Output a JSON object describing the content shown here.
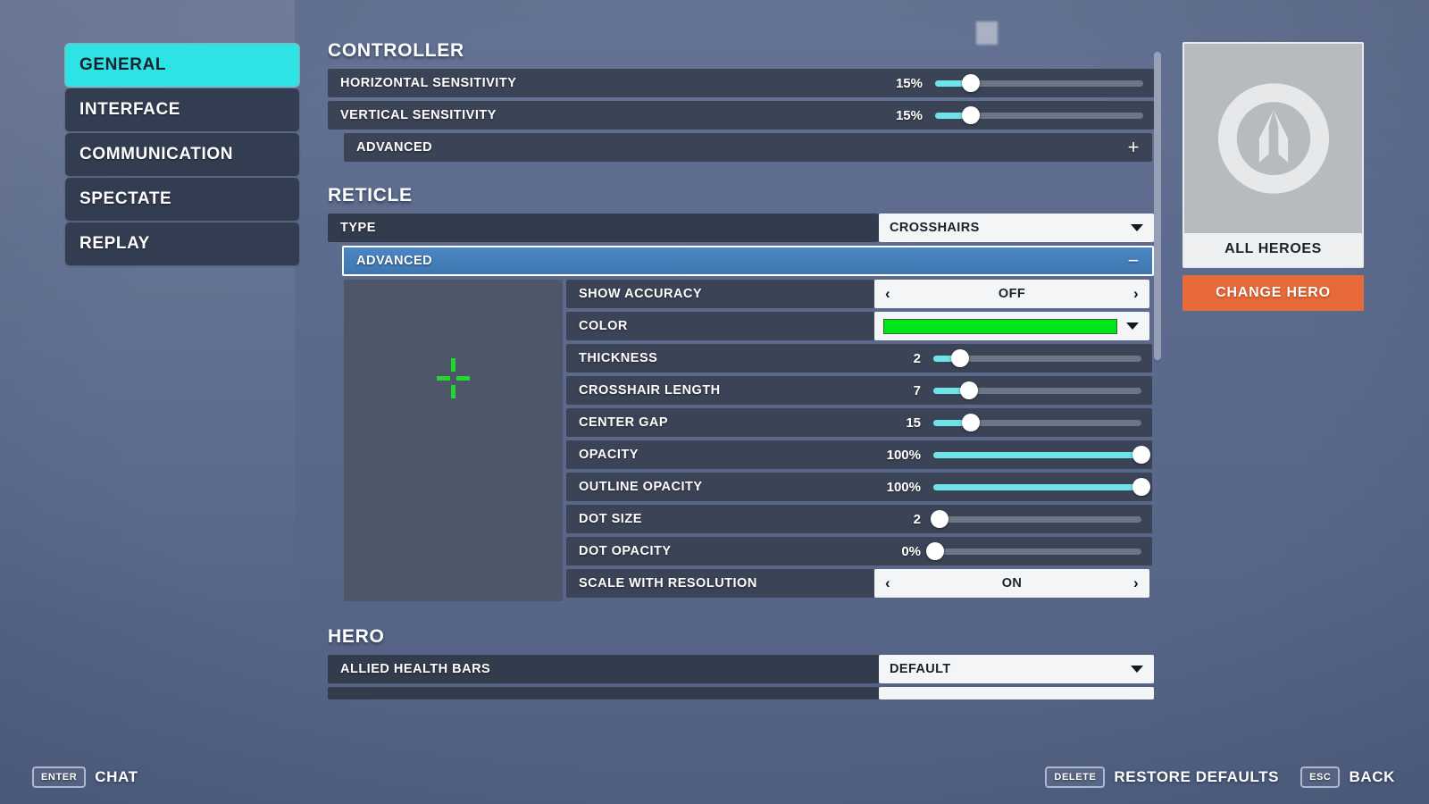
{
  "theme": {
    "accent_cyan": "#2de3e3",
    "slider_fill": "#6fe3e8",
    "selected_blue": "#4a87c4",
    "crosshair_green": "#21d832",
    "change_hero_orange": "#e8693a",
    "row_dark": "#3b4456"
  },
  "sidebar": {
    "items": [
      {
        "label": "GENERAL",
        "active": true
      },
      {
        "label": "INTERFACE",
        "active": false
      },
      {
        "label": "COMMUNICATION",
        "active": false
      },
      {
        "label": "SPECTATE",
        "active": false
      },
      {
        "label": "REPLAY",
        "active": false
      }
    ]
  },
  "sections": {
    "controller": {
      "title": "CONTROLLER",
      "horizontal_sensitivity": {
        "label": "HORIZONTAL SENSITIVITY",
        "value": "15%",
        "percent": 17
      },
      "vertical_sensitivity": {
        "label": "VERTICAL SENSITIVITY",
        "value": "15%",
        "percent": 17
      },
      "advanced": {
        "label": "ADVANCED",
        "sign": "+"
      }
    },
    "reticle": {
      "title": "RETICLE",
      "type": {
        "label": "TYPE",
        "value": "CROSSHAIRS"
      },
      "advanced": {
        "label": "ADVANCED",
        "sign": "−"
      },
      "show_accuracy": {
        "label": "SHOW ACCURACY",
        "value": "OFF",
        "left_arrow": "‹",
        "right_arrow": "›"
      },
      "color": {
        "label": "COLOR",
        "value": "#00e518"
      },
      "thickness": {
        "label": "THICKNESS",
        "value": "2",
        "percent": 13
      },
      "crosshair_length": {
        "label": "CROSSHAIR LENGTH",
        "value": "7",
        "percent": 17
      },
      "center_gap": {
        "label": "CENTER GAP",
        "value": "15",
        "percent": 18
      },
      "opacity": {
        "label": "OPACITY",
        "value": "100%",
        "percent": 100
      },
      "outline_opacity": {
        "label": "OUTLINE OPACITY",
        "value": "100%",
        "percent": 100
      },
      "dot_size": {
        "label": "DOT SIZE",
        "value": "2",
        "percent": 3
      },
      "dot_opacity": {
        "label": "DOT OPACITY",
        "value": "0%",
        "percent": 0
      },
      "scale_with_resolution": {
        "label": "SCALE WITH RESOLUTION",
        "value": "ON",
        "left_arrow": "‹",
        "right_arrow": "›"
      }
    },
    "hero": {
      "title": "HERO",
      "allied_health_bars": {
        "label": "ALLIED HEALTH BARS",
        "value": "DEFAULT"
      }
    }
  },
  "hero_panel": {
    "logo_icon": "overwatch-logo-icon",
    "name": "ALL HEROES",
    "change_button": "CHANGE HERO"
  },
  "bottom_bar": {
    "chat": {
      "key": "ENTER",
      "label": "CHAT"
    },
    "restore": {
      "key": "DELETE",
      "label": "RESTORE DEFAULTS"
    },
    "back": {
      "key": "ESC",
      "label": "BACK"
    }
  }
}
